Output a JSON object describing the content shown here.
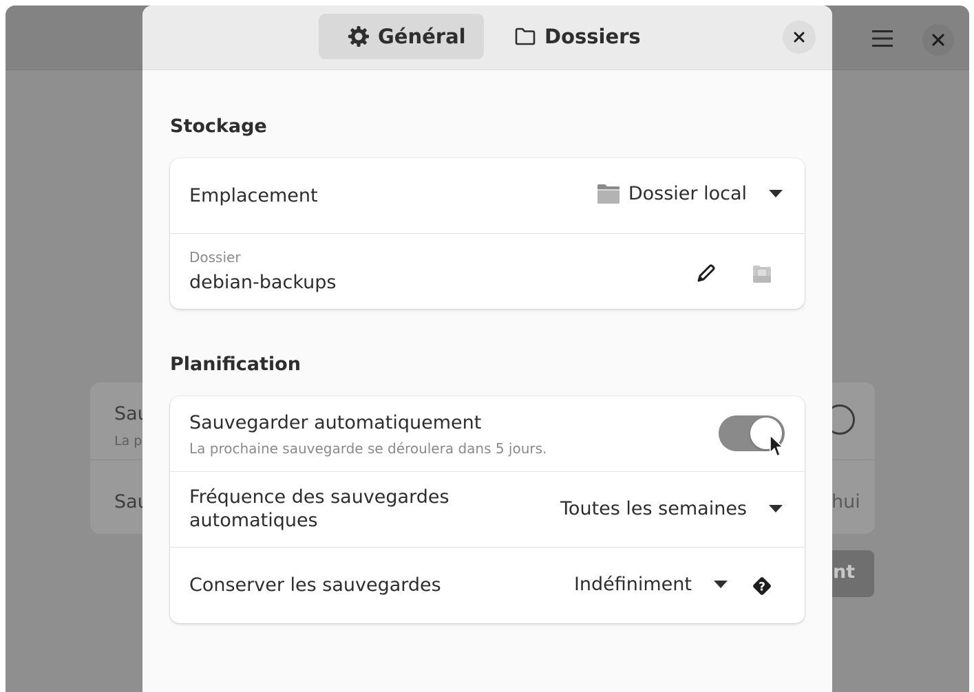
{
  "background": {
    "card_row1_title": "Sau",
    "card_row1_subtitle": "La p",
    "card_row2_title": "Sau",
    "card_row2_value": "hui",
    "action_button_label": "nt"
  },
  "dialog": {
    "tabs": [
      {
        "label": "Général",
        "icon": "gear-icon",
        "active": true
      },
      {
        "label": "Dossiers",
        "icon": "folder-icon",
        "active": false
      }
    ],
    "storage": {
      "heading": "Stockage",
      "location_label": "Emplacement",
      "location_value": "Dossier local",
      "folder_caption": "Dossier",
      "folder_value": "debian-backups"
    },
    "schedule": {
      "heading": "Planification",
      "auto_label": "Sauvegarder automatiquement",
      "auto_subtitle": "La prochaine sauvegarde se déroulera dans 5 jours.",
      "auto_enabled": true,
      "frequency_label_line1": "Fréquence des sauvegardes",
      "frequency_label_line2": "automatiques",
      "frequency_value": "Toutes les semaines",
      "keep_label": "Conserver les sauvegardes",
      "keep_value": "Indéfiniment"
    }
  },
  "colors": {
    "dim_overlay": "#8f8f8f",
    "dialog_bg": "#fafafa",
    "header_bg": "#ebebeb",
    "toggle_on": "#8a8a8a",
    "text": "#2e2e2e",
    "muted_text": "#8a8a8a"
  }
}
